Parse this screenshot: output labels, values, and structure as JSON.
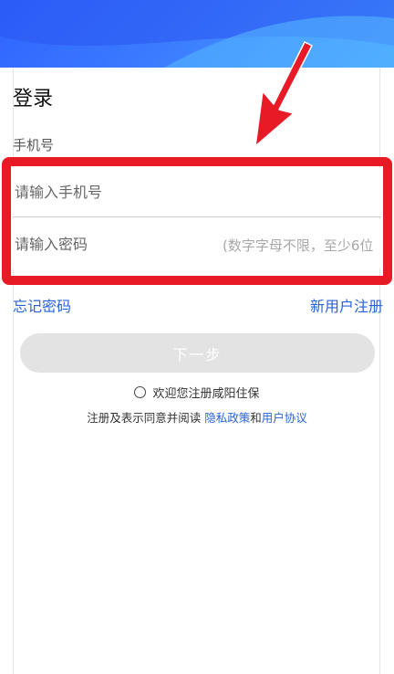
{
  "header": {
    "background_colors": [
      "#2f63ff",
      "#4aa8ff"
    ]
  },
  "login": {
    "title": "登录",
    "section_label": "手机号",
    "phone_placeholder": "请输入手机号",
    "password_placeholder": "请输入密码",
    "password_hint": "(数字字母不限，至少6位",
    "forgot_password": "忘记密码",
    "new_user_register": "新用户注册",
    "next_button": "下一步",
    "agree_text": "欢迎您注册咸阳住保",
    "terms_prefix": "注册及表示同意并阅读 ",
    "privacy_policy": "隐私政策",
    "terms_and": "和",
    "user_agreement": "用户协议"
  },
  "annotation": {
    "highlight_color": "#e81a26",
    "arrow_icon": "arrow-pointer-icon"
  },
  "colors": {
    "link": "#2a62d9",
    "disabled_button": "#e3e3e3"
  }
}
